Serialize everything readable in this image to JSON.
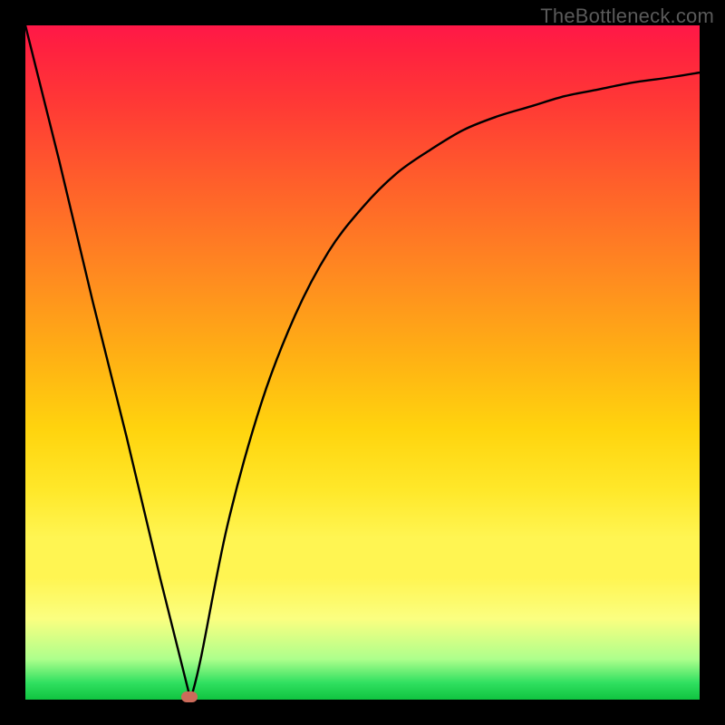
{
  "watermark": "TheBottleneck.com",
  "chart_data": {
    "type": "line",
    "title": "",
    "xlabel": "",
    "ylabel": "",
    "xlim": [
      0,
      100
    ],
    "ylim": [
      0,
      100
    ],
    "gradient_stops": [
      {
        "pos": 0,
        "color": "#ff1848"
      },
      {
        "pos": 12,
        "color": "#ff3a35"
      },
      {
        "pos": 23,
        "color": "#ff5e2b"
      },
      {
        "pos": 37,
        "color": "#ff8a20"
      },
      {
        "pos": 49,
        "color": "#ffb014"
      },
      {
        "pos": 60,
        "color": "#ffd40e"
      },
      {
        "pos": 69,
        "color": "#ffe82a"
      },
      {
        "pos": 82,
        "color": "#fff552"
      },
      {
        "pos": 94,
        "color": "#adff8c"
      },
      {
        "pos": 100,
        "color": "#10c440"
      }
    ],
    "series": [
      {
        "name": "bottleneck-curve",
        "x": [
          0,
          5,
          10,
          15,
          20,
          24.5,
          26,
          30,
          35,
          40,
          45,
          50,
          55,
          60,
          65,
          70,
          75,
          80,
          85,
          90,
          95,
          100
        ],
        "y": [
          100,
          80,
          59,
          39,
          18,
          0,
          6,
          26,
          44,
          57,
          66.5,
          73,
          78,
          81.5,
          84.5,
          86.5,
          88,
          89.5,
          90.5,
          91.5,
          92.2,
          93
        ]
      }
    ],
    "minimum_point": {
      "x": 24.5,
      "y": 0
    },
    "marker": {
      "x": 24.3,
      "y": 0.4,
      "color": "#cc6b5a"
    }
  }
}
